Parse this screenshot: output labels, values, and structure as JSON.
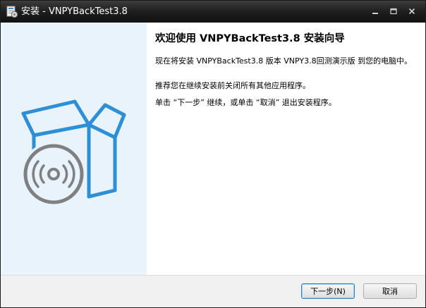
{
  "window": {
    "title": "安装 - VNPYBackTest3.8",
    "controls": [
      "minimize-icon",
      "maximize-icon",
      "close-icon"
    ]
  },
  "content": {
    "heading": "欢迎使用 VNPYBackTest3.8 安装向导",
    "paragraphs": [
      "现在将安装 VNPYBackTest3.8 版本 VNPY3.8回测演示版 到您的电脑中。",
      "推荐您在继续安装前关闭所有其他应用程序。",
      "单击 “下一步” 继续，或单击 “取消” 退出安装程序。"
    ]
  },
  "buttons": {
    "next": "下一步(N)",
    "cancel": "取消"
  },
  "icons": {
    "app": "installer-icon",
    "art": "software-box-with-disc-icon"
  },
  "colors": {
    "titlebar": "#1c1c1c",
    "left_panel": "#e8f3fb",
    "art_blue": "#2d8fd5",
    "disc_gray": "#7f8082"
  }
}
